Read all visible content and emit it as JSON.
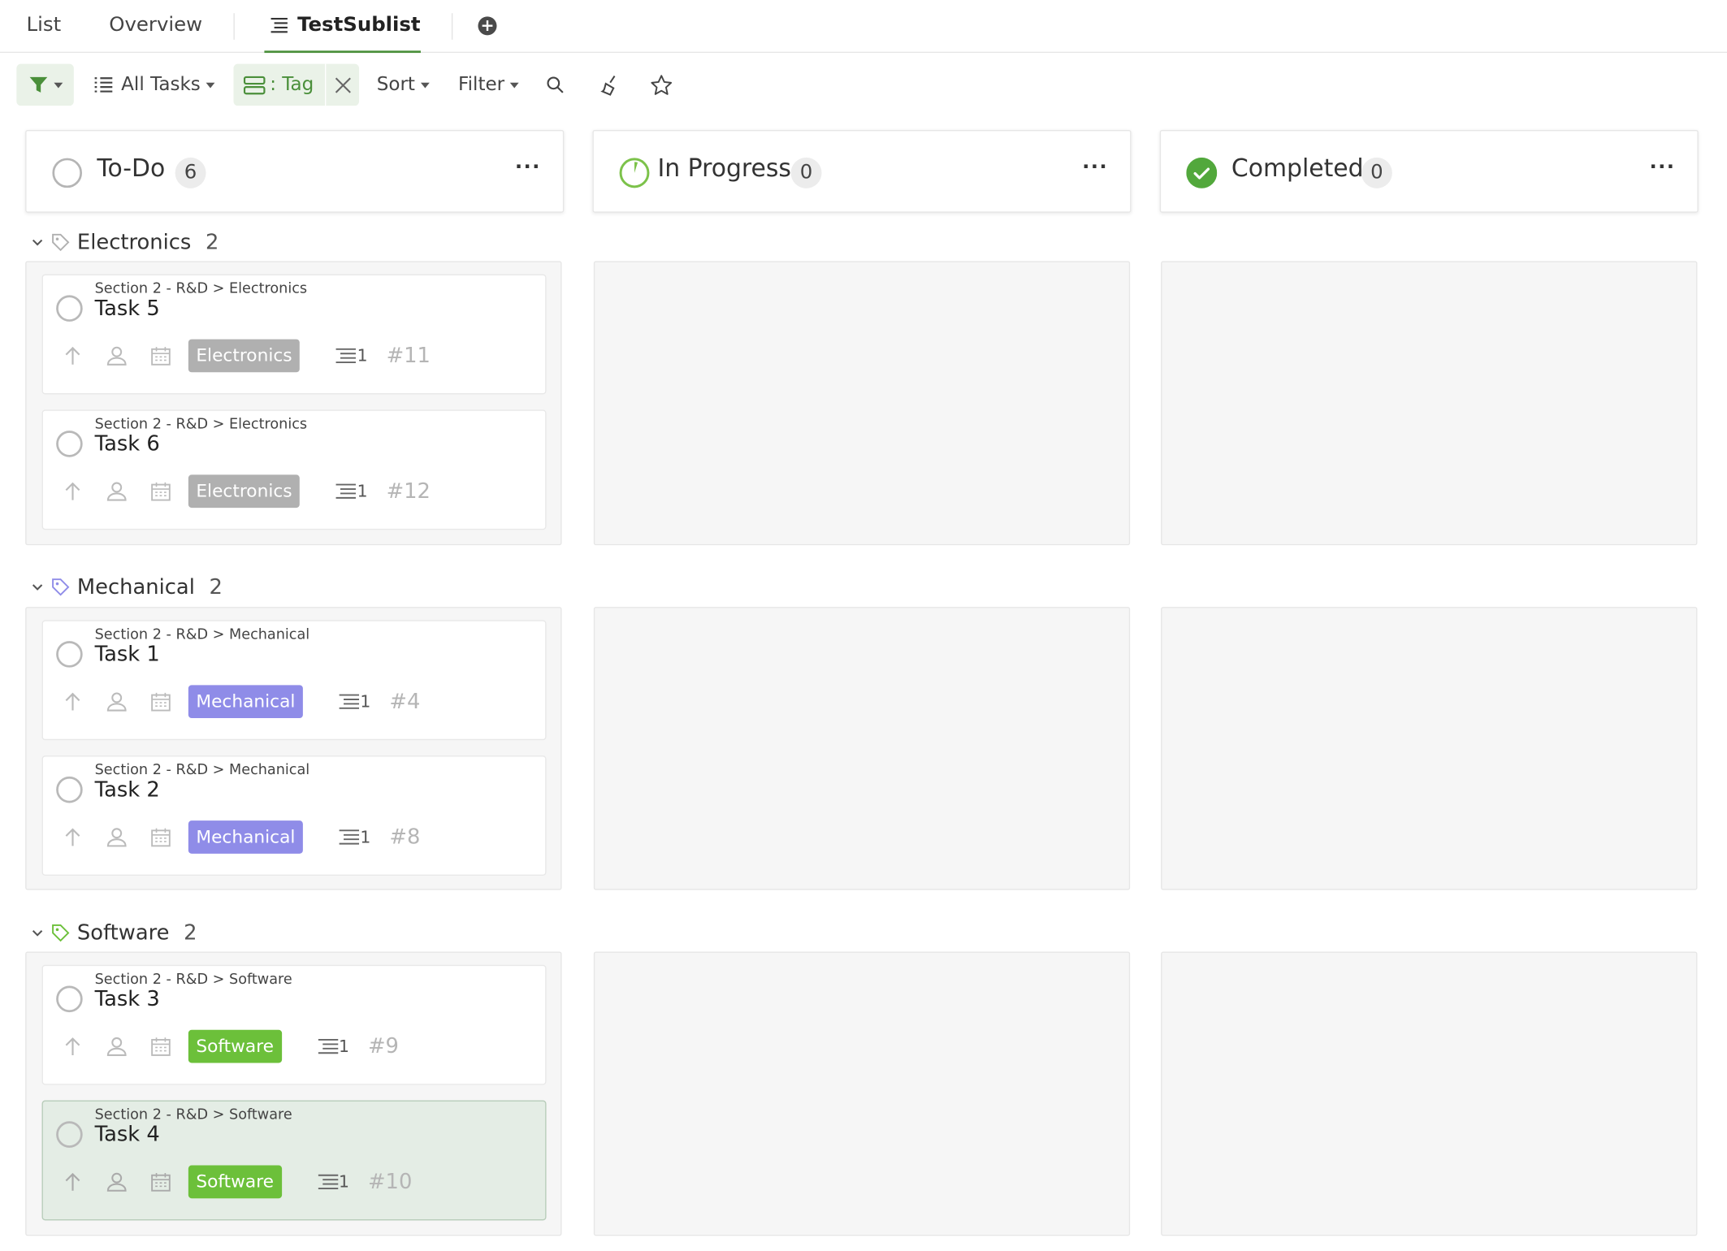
{
  "tabs": [
    {
      "label": "List"
    },
    {
      "label": "Overview"
    },
    {
      "label": "TestSublist"
    }
  ],
  "toolbar": {
    "view": "All Tasks",
    "group_by": ": Tag",
    "sort": "Sort",
    "filter": "Filter"
  },
  "columns": [
    {
      "title": "To-Do",
      "count": "6"
    },
    {
      "title": "In Progress",
      "count": "0"
    },
    {
      "title": "Completed",
      "count": "0"
    }
  ],
  "groups": [
    {
      "name": "Electronics",
      "count": "2",
      "tag_color": "#b0b0b0",
      "tasks": [
        {
          "path": "Section 2 - R&D > Electronics",
          "name": "Task 5",
          "tag": "Electronics",
          "subtasks": "1",
          "id": "#11"
        },
        {
          "path": "Section 2 - R&D > Electronics",
          "name": "Task 6",
          "tag": "Electronics",
          "subtasks": "1",
          "id": "#12"
        }
      ]
    },
    {
      "name": "Mechanical",
      "count": "2",
      "tag_color": "#8f8ce8",
      "tasks": [
        {
          "path": "Section 2 - R&D > Mechanical",
          "name": "Task 1",
          "tag": "Mechanical",
          "subtasks": "1",
          "id": "#4"
        },
        {
          "path": "Section 2 - R&D > Mechanical",
          "name": "Task 2",
          "tag": "Mechanical",
          "subtasks": "1",
          "id": "#8"
        }
      ]
    },
    {
      "name": "Software",
      "count": "2",
      "tag_color": "#6cc03a",
      "tasks": [
        {
          "path": "Section 2 - R&D > Software",
          "name": "Task 3",
          "tag": "Software",
          "subtasks": "1",
          "id": "#9"
        },
        {
          "path": "Section 2 - R&D > Software",
          "name": "Task 4",
          "tag": "Software",
          "subtasks": "1",
          "id": "#10"
        }
      ]
    }
  ],
  "colors": {
    "accent": "#4a8f3a",
    "electronics_tag": "#b0b0b0",
    "mechanical_tag": "#8f8ce8",
    "software_tag": "#6cc03a",
    "selected_card": "#e4ede5"
  }
}
